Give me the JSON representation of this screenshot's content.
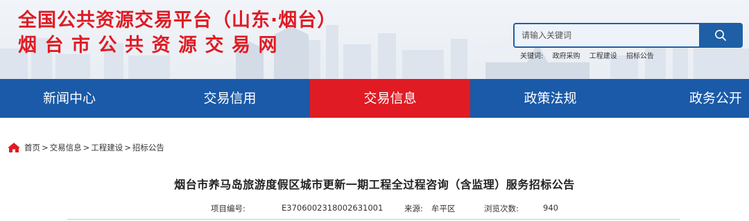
{
  "header": {
    "title_line1": "全国公共资源交易平台（山东·烟台）",
    "title_line2": "烟台市公共资源交易网",
    "brand_color": "#e01b24"
  },
  "search": {
    "placeholder": "请输入关键词",
    "button_icon": "search-icon",
    "keywords_label": "关键词:",
    "keywords": [
      "政府采购",
      "工程建设",
      "招标公告"
    ]
  },
  "nav": {
    "items": [
      {
        "label": "新闻中心",
        "active": false
      },
      {
        "label": "交易信用",
        "active": false
      },
      {
        "label": "交易信息",
        "active": true
      },
      {
        "label": "政策法规",
        "active": false
      },
      {
        "label": "政务公开",
        "active": false
      }
    ],
    "bg_color": "#1a5aa8",
    "active_color": "#e01b24"
  },
  "breadcrumb": {
    "icon": "home-icon",
    "items": [
      "首页",
      "交易信息",
      "工程建设",
      "招标公告"
    ],
    "separator": ">"
  },
  "article": {
    "title": "烟台市养马岛旅游度假区城市更新一期工程全过程咨询（含监理）服务招标公告",
    "project_no_label": "项目编号:",
    "project_no": "E3706002318002631001",
    "source_label": "来源:",
    "source": "牟平区",
    "views_label": "浏览次数:",
    "views": "940"
  }
}
